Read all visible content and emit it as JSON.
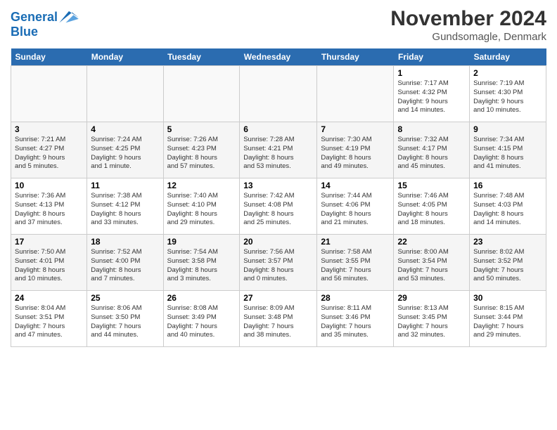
{
  "logo": {
    "line1": "General",
    "line2": "Blue"
  },
  "title": "November 2024",
  "location": "Gundsomagle, Denmark",
  "days_of_week": [
    "Sunday",
    "Monday",
    "Tuesday",
    "Wednesday",
    "Thursday",
    "Friday",
    "Saturday"
  ],
  "weeks": [
    {
      "shade": false,
      "days": [
        {
          "num": "",
          "info": "",
          "empty": true
        },
        {
          "num": "",
          "info": "",
          "empty": true
        },
        {
          "num": "",
          "info": "",
          "empty": true
        },
        {
          "num": "",
          "info": "",
          "empty": true
        },
        {
          "num": "",
          "info": "",
          "empty": true
        },
        {
          "num": "1",
          "info": "Sunrise: 7:17 AM\nSunset: 4:32 PM\nDaylight: 9 hours\nand 14 minutes.",
          "empty": false
        },
        {
          "num": "2",
          "info": "Sunrise: 7:19 AM\nSunset: 4:30 PM\nDaylight: 9 hours\nand 10 minutes.",
          "empty": false
        }
      ]
    },
    {
      "shade": true,
      "days": [
        {
          "num": "3",
          "info": "Sunrise: 7:21 AM\nSunset: 4:27 PM\nDaylight: 9 hours\nand 5 minutes.",
          "empty": false
        },
        {
          "num": "4",
          "info": "Sunrise: 7:24 AM\nSunset: 4:25 PM\nDaylight: 9 hours\nand 1 minute.",
          "empty": false
        },
        {
          "num": "5",
          "info": "Sunrise: 7:26 AM\nSunset: 4:23 PM\nDaylight: 8 hours\nand 57 minutes.",
          "empty": false
        },
        {
          "num": "6",
          "info": "Sunrise: 7:28 AM\nSunset: 4:21 PM\nDaylight: 8 hours\nand 53 minutes.",
          "empty": false
        },
        {
          "num": "7",
          "info": "Sunrise: 7:30 AM\nSunset: 4:19 PM\nDaylight: 8 hours\nand 49 minutes.",
          "empty": false
        },
        {
          "num": "8",
          "info": "Sunrise: 7:32 AM\nSunset: 4:17 PM\nDaylight: 8 hours\nand 45 minutes.",
          "empty": false
        },
        {
          "num": "9",
          "info": "Sunrise: 7:34 AM\nSunset: 4:15 PM\nDaylight: 8 hours\nand 41 minutes.",
          "empty": false
        }
      ]
    },
    {
      "shade": false,
      "days": [
        {
          "num": "10",
          "info": "Sunrise: 7:36 AM\nSunset: 4:13 PM\nDaylight: 8 hours\nand 37 minutes.",
          "empty": false
        },
        {
          "num": "11",
          "info": "Sunrise: 7:38 AM\nSunset: 4:12 PM\nDaylight: 8 hours\nand 33 minutes.",
          "empty": false
        },
        {
          "num": "12",
          "info": "Sunrise: 7:40 AM\nSunset: 4:10 PM\nDaylight: 8 hours\nand 29 minutes.",
          "empty": false
        },
        {
          "num": "13",
          "info": "Sunrise: 7:42 AM\nSunset: 4:08 PM\nDaylight: 8 hours\nand 25 minutes.",
          "empty": false
        },
        {
          "num": "14",
          "info": "Sunrise: 7:44 AM\nSunset: 4:06 PM\nDaylight: 8 hours\nand 21 minutes.",
          "empty": false
        },
        {
          "num": "15",
          "info": "Sunrise: 7:46 AM\nSunset: 4:05 PM\nDaylight: 8 hours\nand 18 minutes.",
          "empty": false
        },
        {
          "num": "16",
          "info": "Sunrise: 7:48 AM\nSunset: 4:03 PM\nDaylight: 8 hours\nand 14 minutes.",
          "empty": false
        }
      ]
    },
    {
      "shade": true,
      "days": [
        {
          "num": "17",
          "info": "Sunrise: 7:50 AM\nSunset: 4:01 PM\nDaylight: 8 hours\nand 10 minutes.",
          "empty": false
        },
        {
          "num": "18",
          "info": "Sunrise: 7:52 AM\nSunset: 4:00 PM\nDaylight: 8 hours\nand 7 minutes.",
          "empty": false
        },
        {
          "num": "19",
          "info": "Sunrise: 7:54 AM\nSunset: 3:58 PM\nDaylight: 8 hours\nand 3 minutes.",
          "empty": false
        },
        {
          "num": "20",
          "info": "Sunrise: 7:56 AM\nSunset: 3:57 PM\nDaylight: 8 hours\nand 0 minutes.",
          "empty": false
        },
        {
          "num": "21",
          "info": "Sunrise: 7:58 AM\nSunset: 3:55 PM\nDaylight: 7 hours\nand 56 minutes.",
          "empty": false
        },
        {
          "num": "22",
          "info": "Sunrise: 8:00 AM\nSunset: 3:54 PM\nDaylight: 7 hours\nand 53 minutes.",
          "empty": false
        },
        {
          "num": "23",
          "info": "Sunrise: 8:02 AM\nSunset: 3:52 PM\nDaylight: 7 hours\nand 50 minutes.",
          "empty": false
        }
      ]
    },
    {
      "shade": false,
      "days": [
        {
          "num": "24",
          "info": "Sunrise: 8:04 AM\nSunset: 3:51 PM\nDaylight: 7 hours\nand 47 minutes.",
          "empty": false
        },
        {
          "num": "25",
          "info": "Sunrise: 8:06 AM\nSunset: 3:50 PM\nDaylight: 7 hours\nand 44 minutes.",
          "empty": false
        },
        {
          "num": "26",
          "info": "Sunrise: 8:08 AM\nSunset: 3:49 PM\nDaylight: 7 hours\nand 40 minutes.",
          "empty": false
        },
        {
          "num": "27",
          "info": "Sunrise: 8:09 AM\nSunset: 3:48 PM\nDaylight: 7 hours\nand 38 minutes.",
          "empty": false
        },
        {
          "num": "28",
          "info": "Sunrise: 8:11 AM\nSunset: 3:46 PM\nDaylight: 7 hours\nand 35 minutes.",
          "empty": false
        },
        {
          "num": "29",
          "info": "Sunrise: 8:13 AM\nSunset: 3:45 PM\nDaylight: 7 hours\nand 32 minutes.",
          "empty": false
        },
        {
          "num": "30",
          "info": "Sunrise: 8:15 AM\nSunset: 3:44 PM\nDaylight: 7 hours\nand 29 minutes.",
          "empty": false
        }
      ]
    }
  ]
}
